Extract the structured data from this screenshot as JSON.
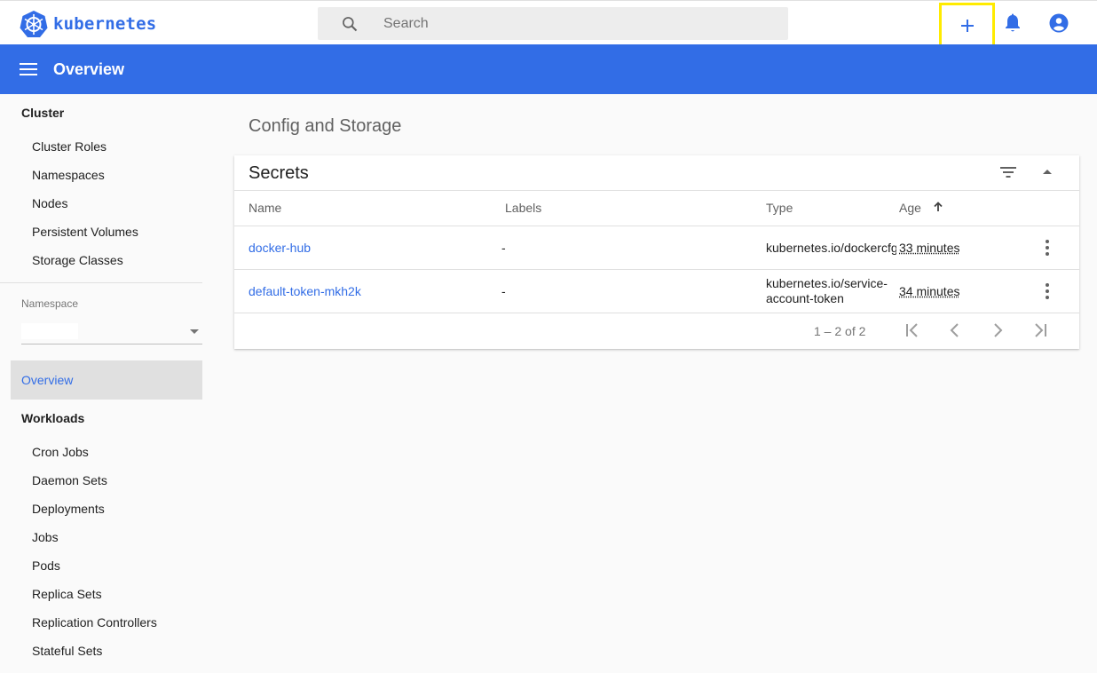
{
  "app": {
    "brand": "kubernetes",
    "accent_color": "#326de6"
  },
  "search": {
    "placeholder": "Search",
    "icon": "search-icon"
  },
  "topbar_actions": [
    {
      "icon": "plus-icon",
      "highlighted": true
    },
    {
      "icon": "bell-icon"
    },
    {
      "icon": "account-circle-icon"
    }
  ],
  "toolbar": {
    "title": "Overview"
  },
  "sidebar": {
    "cluster_heading": "Cluster",
    "cluster_items": [
      "Cluster Roles",
      "Namespaces",
      "Nodes",
      "Persistent Volumes",
      "Storage Classes"
    ],
    "namespace_label": "Namespace",
    "overview": "Overview",
    "workloads_heading": "Workloads",
    "workload_items": [
      "Cron Jobs",
      "Daemon Sets",
      "Deployments",
      "Jobs",
      "Pods",
      "Replica Sets",
      "Replication Controllers",
      "Stateful Sets"
    ]
  },
  "main": {
    "section_title": "Config and Storage",
    "card": {
      "title": "Secrets",
      "columns": [
        "Name",
        "Labels",
        "Type",
        "Age"
      ],
      "rows": [
        {
          "name": "docker-hub",
          "labels": "-",
          "type": "kubernetes.io/dockercfg",
          "age": "33 minutes"
        },
        {
          "name": "default-token-mkh2k",
          "labels": "-",
          "type": "kubernetes.io/service-account-token",
          "age": "34 minutes"
        }
      ],
      "pagination": "1 – 2 of 2"
    }
  }
}
